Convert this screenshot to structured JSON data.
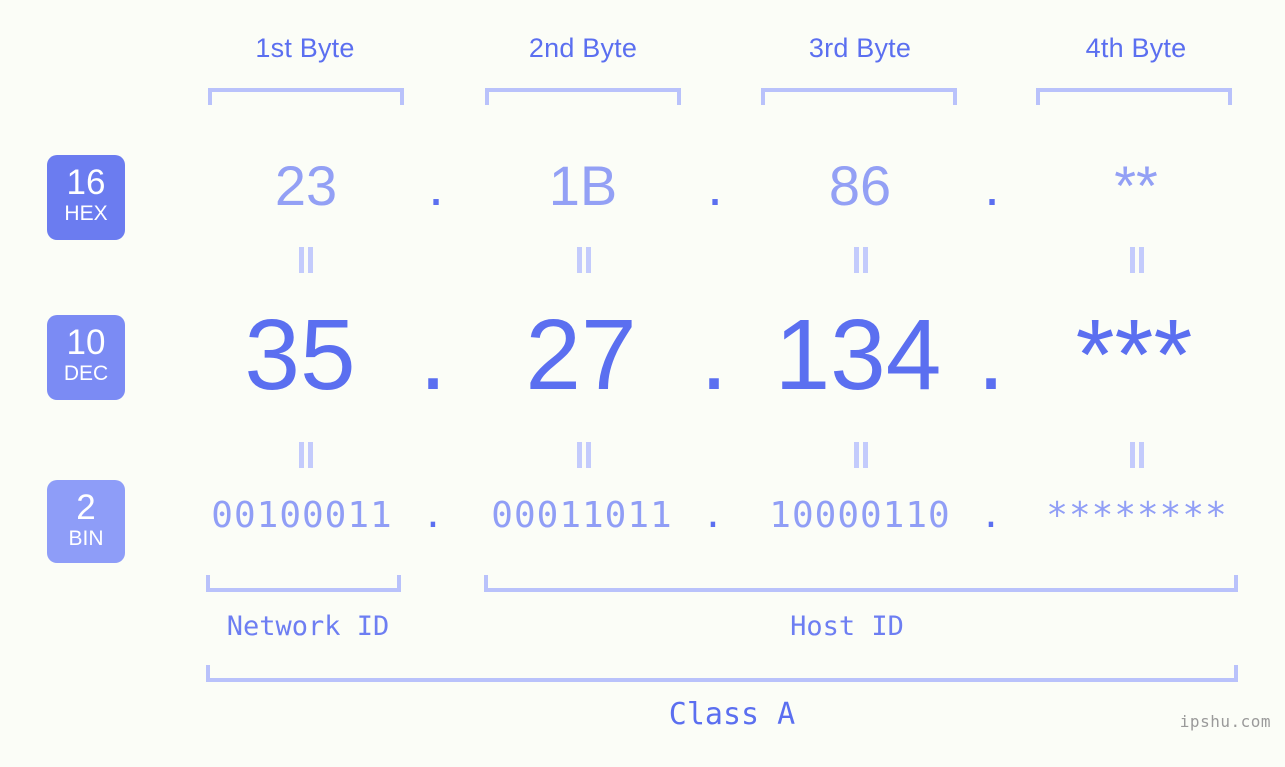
{
  "background_color": "#fbfdf7",
  "accent_color": "#5b6ff0",
  "accent_light_color": "#93a0f5",
  "bracket_color": "#b9c2fb",
  "header": {
    "bytes": [
      {
        "label": "1st Byte"
      },
      {
        "label": "2nd Byte"
      },
      {
        "label": "3rd Byte"
      },
      {
        "label": "4th Byte"
      }
    ]
  },
  "rows": {
    "hex": {
      "badge_number": "16",
      "badge_system": "HEX",
      "badge_color": "#6b7cf0",
      "separator": ".",
      "octets": [
        "23",
        "1B",
        "86",
        "**"
      ]
    },
    "dec": {
      "badge_number": "10",
      "badge_system": "DEC",
      "badge_color": "#7b8bf4",
      "separator": ".",
      "octets": [
        "35",
        "27",
        "134",
        "***"
      ]
    },
    "bin": {
      "badge_number": "2",
      "badge_system": "BIN",
      "badge_color": "#8e9df8",
      "separator": ".",
      "octets": [
        "00100011",
        "00011011",
        "10000110",
        "********"
      ]
    }
  },
  "equality_marks": {
    "glyph": "=",
    "count_per_row": 4,
    "rows": 2
  },
  "footer": {
    "network_id_label": "Network ID",
    "host_id_label": "Host ID",
    "class_label": "Class A",
    "watermark": "ipshu.com"
  }
}
